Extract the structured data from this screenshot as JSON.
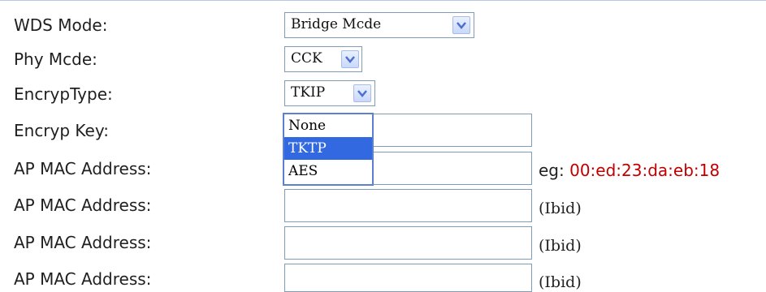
{
  "form": {
    "wds_mode": {
      "label": "WDS Mode:",
      "value": "Bridge Mcde"
    },
    "phy_mode": {
      "label": "Phy Mcde:",
      "value": "CCK"
    },
    "encryp_type": {
      "label": "EncrypType:",
      "value": "TKIP",
      "options": [
        "None",
        "TKTP",
        "AES"
      ],
      "highlighted_option": "TKTP"
    },
    "encryp_key": {
      "label": "Encryp Key:"
    },
    "ap_mac_rows": [
      {
        "label": "AP MAC Address:",
        "hint_prefix": "eg:",
        "hint_value": "00:ed:23:da:eb:18"
      },
      {
        "label": "AP MAC Address:",
        "hint": "(Ibid)"
      },
      {
        "label": "AP MAC Address:",
        "hint": "(Ibid)"
      },
      {
        "label": "AP MAC Address:",
        "hint": "(Ibid)"
      }
    ]
  },
  "colors": {
    "field_border": "#7f9db9",
    "dropdown_highlight": "#3268e0",
    "example_red": "#c00000"
  },
  "icons": {
    "select_arrow": "chevron-down-icon"
  }
}
